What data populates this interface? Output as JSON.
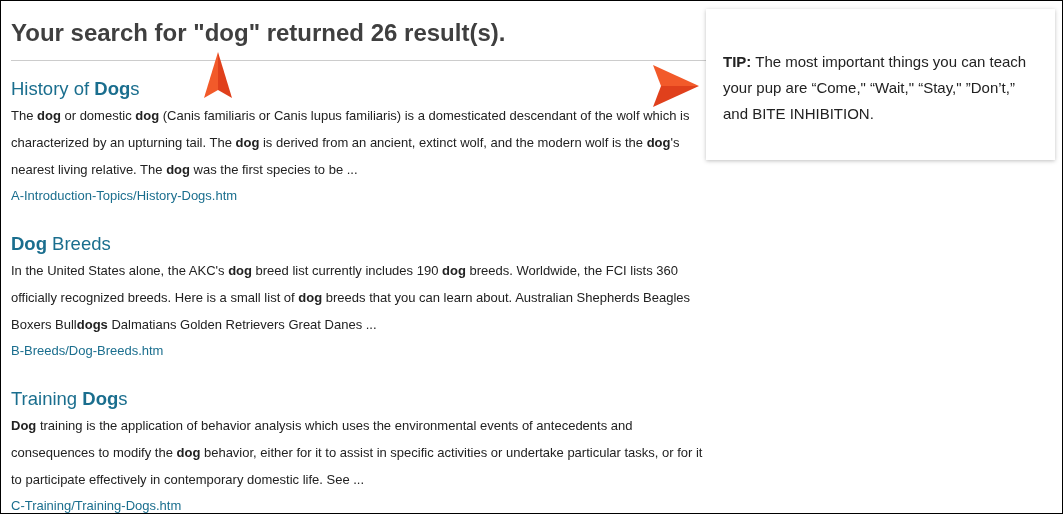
{
  "heading": "Your search for \"dog\" returned 26 result(s).",
  "results": [
    {
      "title": "History of **Dog**s",
      "snippet": "The **dog** or domestic **dog** (Canis familiaris or Canis lupus familiaris) is a domesticated descendant of the wolf which is characterized by an upturning tail. The **dog** is derived from an ancient, extinct wolf, and the modern wolf is the **dog**'s nearest living relative. The **dog** was the first species to be ...",
      "path": "A-Introduction-Topics/History-Dogs.htm"
    },
    {
      "title": "**Dog** Breeds",
      "snippet": "In the United States alone, the AKC's **dog** breed list currently includes 190 **dog** breeds. Worldwide, the FCI lists 360 officially recognized breeds. Here is a small list of **dog** breeds that you can learn about. Australian Shepherds Beagles Boxers Bull**dogs** Dalmatians Golden Retrievers Great Danes ...",
      "path": "B-Breeds/Dog-Breeds.htm"
    },
    {
      "title": "Training **Dog**s",
      "snippet": "**Dog** training is the application of behavior analysis which uses the environmental events of antecedents and consequences to modify the **dog** behavior, either for it to assist in specific activities or undertake particular tasks, or for it to participate effectively in contemporary domestic life. See ...",
      "path": "C-Training/Training-Dogs.htm"
    }
  ],
  "tip": "**TIP:** The most important things you can teach your pup are “Come,\" “Wait,\" “Stay,\" ”Don’t,” and BITE INHIBITION."
}
